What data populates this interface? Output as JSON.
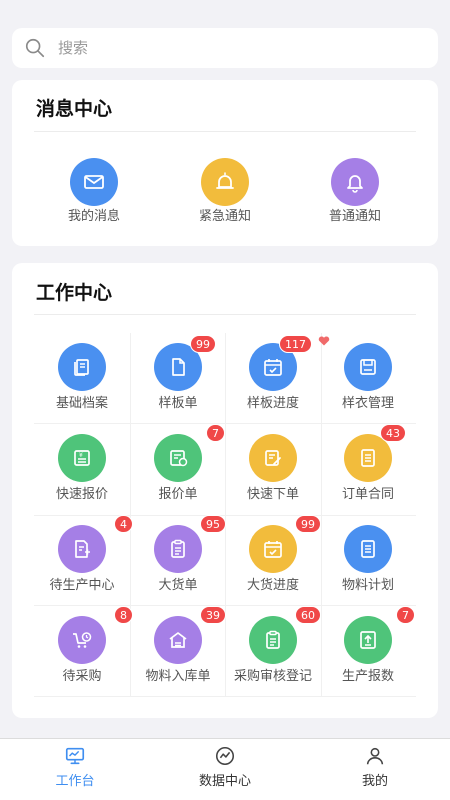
{
  "search": {
    "placeholder": "搜索"
  },
  "message_center": {
    "title": "消息中心",
    "items": [
      {
        "label": "我的消息",
        "icon": "mail-icon",
        "color": "#4a90f0"
      },
      {
        "label": "紧急通知",
        "icon": "alarm-icon",
        "color": "#f2bc3c"
      },
      {
        "label": "普通通知",
        "icon": "bell-icon",
        "color": "#a57fe6"
      }
    ]
  },
  "work_center": {
    "title": "工作中心",
    "items": [
      {
        "label": "基础档案",
        "icon": "archive-icon",
        "color": "#4a90f0",
        "badge": ""
      },
      {
        "label": "样板单",
        "icon": "document-icon",
        "color": "#4a90f0",
        "badge": "99"
      },
      {
        "label": "样板进度",
        "icon": "calendar-check-icon",
        "color": "#4a90f0",
        "badge": "117"
      },
      {
        "label": "样衣管理",
        "icon": "save-icon",
        "color": "#4a90f0",
        "badge": ""
      },
      {
        "label": "快速报价",
        "icon": "quote-icon",
        "color": "#4fc47a",
        "badge": ""
      },
      {
        "label": "报价单",
        "icon": "price-list-icon",
        "color": "#4fc47a",
        "badge": "7"
      },
      {
        "label": "快速下单",
        "icon": "edit-order-icon",
        "color": "#f2bc3c",
        "badge": ""
      },
      {
        "label": "订单合同",
        "icon": "contract-icon",
        "color": "#f2bc3c",
        "badge": "43"
      },
      {
        "label": "待生产中心",
        "icon": "pending-production-icon",
        "color": "#a57fe6",
        "badge": "4"
      },
      {
        "label": "大货单",
        "icon": "clipboard-icon",
        "color": "#a57fe6",
        "badge": "95"
      },
      {
        "label": "大货进度",
        "icon": "calendar-check-icon",
        "color": "#f2bc3c",
        "badge": "99"
      },
      {
        "label": "物料计划",
        "icon": "plan-icon",
        "color": "#4a90f0",
        "badge": ""
      },
      {
        "label": "待采购",
        "icon": "cart-clock-icon",
        "color": "#a57fe6",
        "badge": "8"
      },
      {
        "label": "物料入库单",
        "icon": "warehouse-icon",
        "color": "#a57fe6",
        "badge": "39"
      },
      {
        "label": "采购审核登记",
        "icon": "audit-clipboard-icon",
        "color": "#4fc47a",
        "badge": "60"
      },
      {
        "label": "生产报数",
        "icon": "upload-report-icon",
        "color": "#4fc47a",
        "badge": "7"
      }
    ]
  },
  "tabbar": {
    "items": [
      {
        "label": "工作台",
        "icon": "monitor-icon",
        "active": true
      },
      {
        "label": "数据中心",
        "icon": "chart-icon",
        "active": false
      },
      {
        "label": "我的",
        "icon": "user-icon",
        "active": false
      }
    ],
    "active_color": "#3f8ef0"
  }
}
